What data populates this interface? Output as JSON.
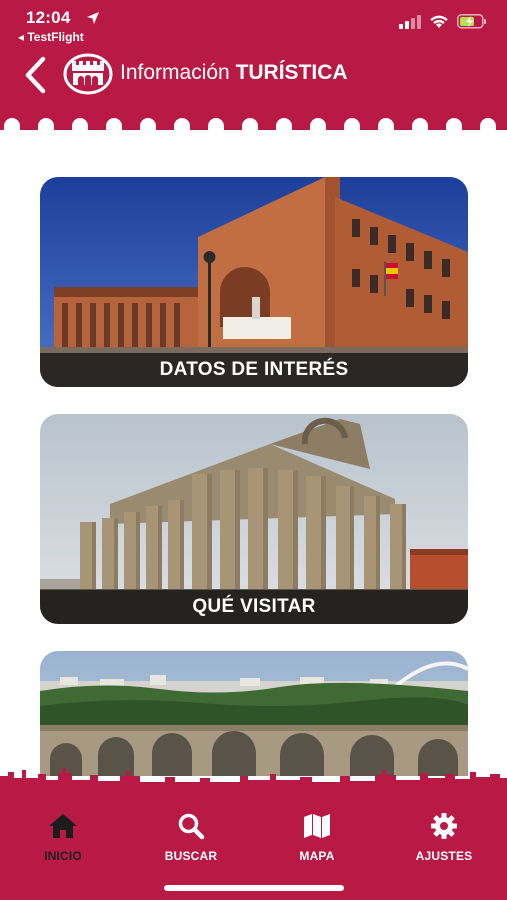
{
  "status_bar": {
    "time": "12:04",
    "back_app": "◂ TestFlight"
  },
  "header": {
    "title_regular": "Información",
    "title_bold": "TURÍSTICA",
    "back_icon": "chevron-left-icon",
    "logo_icon": "city-emblem-icon"
  },
  "cards": [
    {
      "label": "DATOS DE INTERÉS",
      "image": "modern-brick-building-photo"
    },
    {
      "label": "QUÉ VISITAR",
      "image": "roman-temple-photo"
    },
    {
      "label": "",
      "image": "roman-bridge-photo"
    }
  ],
  "tabbar": {
    "items": [
      {
        "label": "INICIO",
        "icon": "home-icon",
        "active": true
      },
      {
        "label": "BUSCAR",
        "icon": "search-icon",
        "active": false
      },
      {
        "label": "MAPA",
        "icon": "map-icon",
        "active": false
      },
      {
        "label": "AJUSTES",
        "icon": "gear-icon",
        "active": false
      }
    ]
  },
  "colors": {
    "brand": "#b91a45",
    "active_tab": "#1c1c1c",
    "battery": "#b6e04e"
  }
}
